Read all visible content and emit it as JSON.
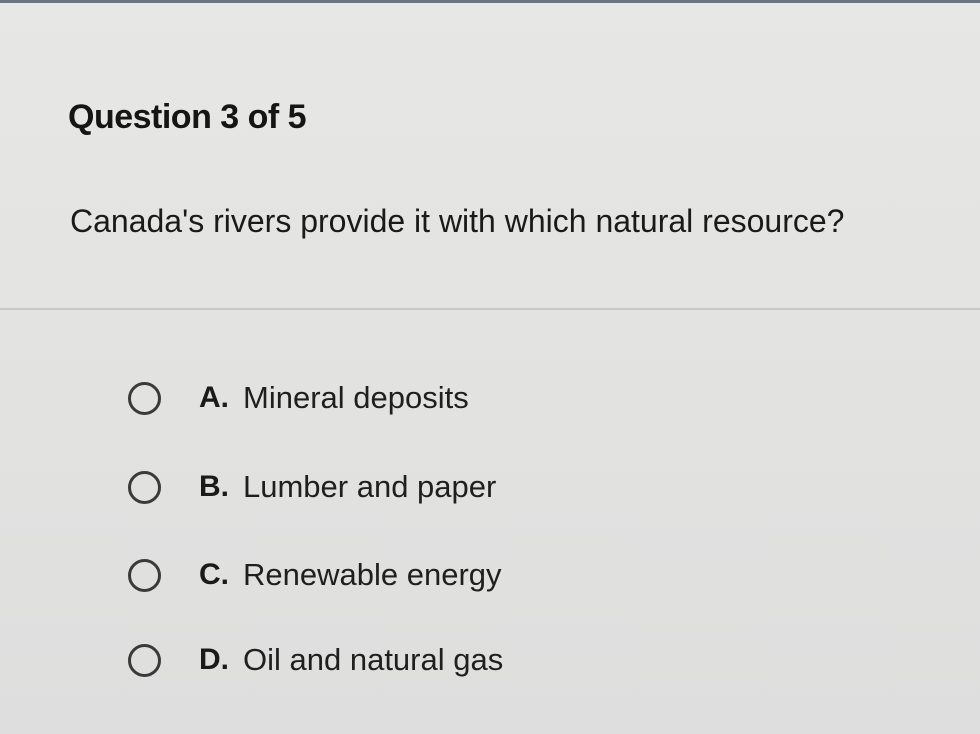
{
  "question": {
    "header": "Question 3 of 5",
    "text": "Canada's rivers provide it with which natural resource?"
  },
  "options": [
    {
      "letter": "A.",
      "label": "Mineral deposits",
      "selected": false
    },
    {
      "letter": "B.",
      "label": "Lumber and paper",
      "selected": false
    },
    {
      "letter": "C.",
      "label": "Renewable energy",
      "selected": false
    },
    {
      "letter": "D.",
      "label": "Oil and natural gas",
      "selected": false
    }
  ]
}
